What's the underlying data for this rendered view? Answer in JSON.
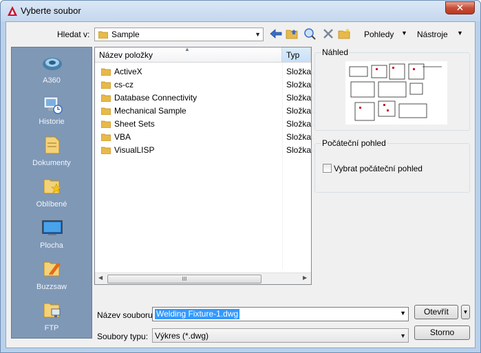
{
  "window": {
    "title": "Vyberte soubor",
    "close_glyph": "✕"
  },
  "toolbar": {
    "lookin_label": "Hledat v:",
    "lookin_value": "Sample",
    "views_label": "Pohledy",
    "tools_label": "Nástroje"
  },
  "places": [
    {
      "label": "A360",
      "icon": "a360-icon"
    },
    {
      "label": "Historie",
      "icon": "history-icon"
    },
    {
      "label": "Dokumenty",
      "icon": "documents-icon"
    },
    {
      "label": "Oblíbené",
      "icon": "favorites-icon"
    },
    {
      "label": "Plocha",
      "icon": "desktop-icon"
    },
    {
      "label": "Buzzsaw",
      "icon": "buzzsaw-icon"
    },
    {
      "label": "FTP",
      "icon": "ftp-icon"
    }
  ],
  "filelist": {
    "col_name": "Název položky",
    "col_type": "Typ",
    "items": [
      {
        "name": "ActiveX",
        "type": "Složka souborů"
      },
      {
        "name": "cs-cz",
        "type": "Složka souborů"
      },
      {
        "name": "Database Connectivity",
        "type": "Složka souborů"
      },
      {
        "name": "Mechanical Sample",
        "type": "Složka souborů"
      },
      {
        "name": "Sheet Sets",
        "type": "Složka souborů"
      },
      {
        "name": "VBA",
        "type": "Složka souborů"
      },
      {
        "name": "VisualLISP",
        "type": "Složka souborů"
      }
    ],
    "hscroll_grip": "III"
  },
  "preview": {
    "label": "Náhled"
  },
  "initial_view": {
    "label": "Počáteční pohled",
    "checkbox_label": "Vybrat počáteční pohled",
    "checked": false
  },
  "filename": {
    "label": "Název souboru:",
    "value": "Welding Fixture-1.dwg"
  },
  "filetype": {
    "label": "Soubory typu:",
    "value": "Výkres (*.dwg)"
  },
  "buttons": {
    "open": "Otevřít",
    "cancel": "Storno"
  },
  "colors": {
    "places_bg": "#7f98b6",
    "selection": "#3399ff",
    "close": "#c74e37"
  }
}
